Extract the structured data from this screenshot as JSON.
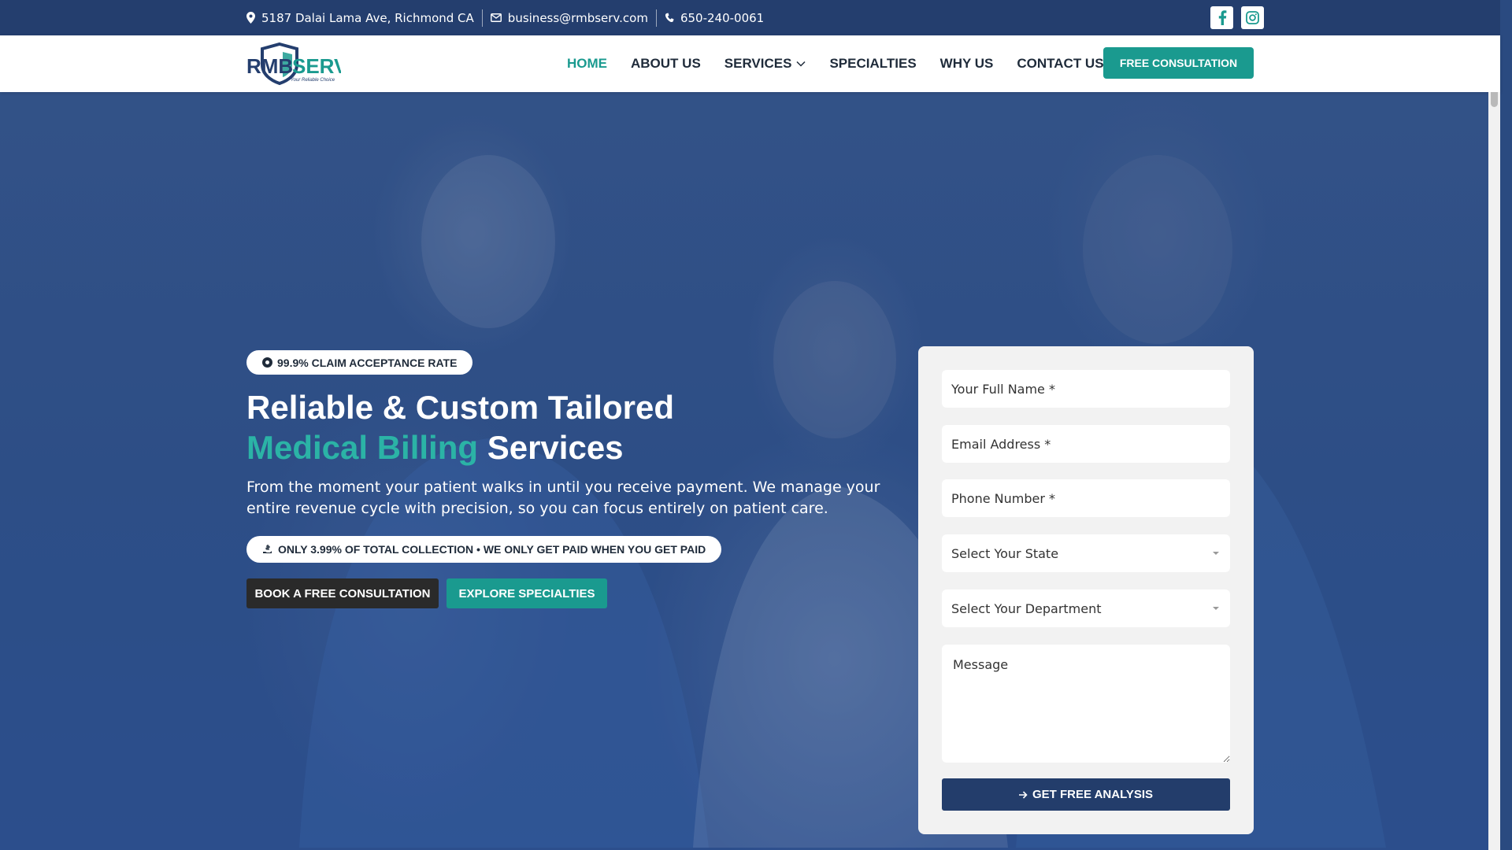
{
  "topbar": {
    "address": "5187 Dalai Lama Ave, Richmond CA",
    "email": "business@rmbserv.com",
    "phone": "650-240-0061",
    "social": [
      "facebook-icon",
      "instagram-icon"
    ]
  },
  "header": {
    "logo_text": "RMBSERV",
    "logo_tagline": "Your Reliable Choice",
    "nav": [
      {
        "label": "HOME",
        "active": true
      },
      {
        "label": "ABOUT US"
      },
      {
        "label": "SERVICES",
        "dropdown": true
      },
      {
        "label": "SPECIALTIES"
      },
      {
        "label": "WHY US"
      },
      {
        "label": "CONTACT US"
      }
    ],
    "cta_label": "FREE CONSULTATION"
  },
  "hero": {
    "badge": "99.9% CLAIM ACCEPTANCE RATE",
    "title_line1": "Reliable & Custom Tailored",
    "title_accent": "Medical Billing",
    "title_rest": "Services",
    "subtitle": "From the moment your patient walks in until you receive payment. We manage your entire revenue cycle with precision, so you can focus entirely on patient care.",
    "pricing_pill": "ONLY 3.99% OF TOTAL COLLECTION • WE ONLY GET PAID WHEN YOU GET PAID",
    "primary_button": "BOOK A FREE CONSULTATION",
    "secondary_button": "EXPLORE SPECIALTIES"
  },
  "form": {
    "name_placeholder": "Your Full Name *",
    "email_placeholder": "Email Address *",
    "phone_placeholder": "Phone Number *",
    "state_select": "Select Your State",
    "department_select": "Select Your Department",
    "message_placeholder": "Message",
    "submit_label": "GET FREE ANALYSIS"
  },
  "colors": {
    "brand_navy": "#243e6e",
    "accent_teal": "#1a9a8f",
    "text_dark": "#1f2b3a"
  }
}
